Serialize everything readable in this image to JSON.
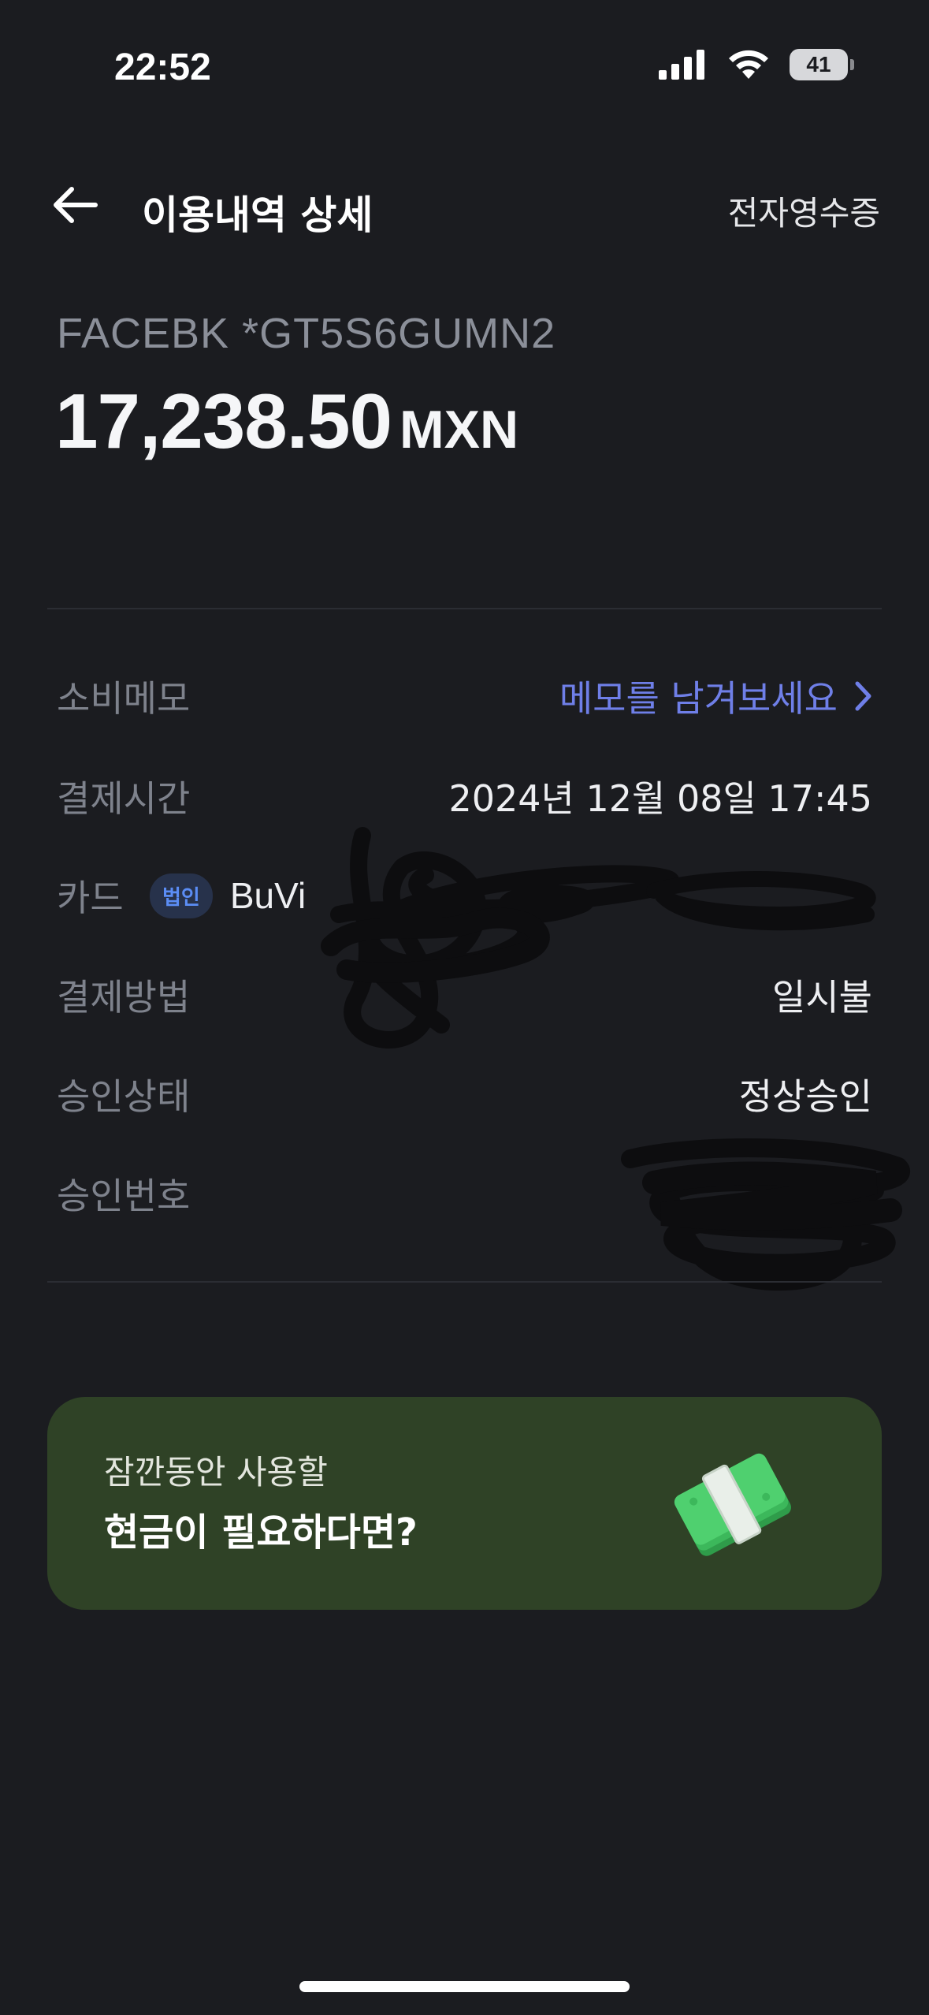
{
  "status_bar": {
    "time": "22:52",
    "battery": "41"
  },
  "header": {
    "title": "이용내역 상세",
    "receipt_link": "전자영수증"
  },
  "transaction": {
    "merchant": "FACEBK *GT5S6GUMN2",
    "amount": "17,238.50",
    "currency": "MXN"
  },
  "details": {
    "memo_label": "소비메모",
    "memo_value": "메모를 남겨보세요",
    "time_label": "결제시간",
    "time_value": "2024년 12월 08일 17:45",
    "card_label": "카드",
    "card_badge": "법인",
    "card_value_visible": "BuVi",
    "method_label": "결제방법",
    "method_value": "일시불",
    "status_label": "승인상태",
    "status_value": "정상승인",
    "approval_label": "승인번호"
  },
  "promo": {
    "subtitle": "잠깐동안 사용할",
    "title": "현금이 필요하다면?",
    "icon": "cash-bundle-icon"
  },
  "colors": {
    "background": "#1b1c20",
    "accent_link": "#6f7fe8",
    "promo_bg": "#2f4226",
    "badge_text": "#5b8df5"
  }
}
